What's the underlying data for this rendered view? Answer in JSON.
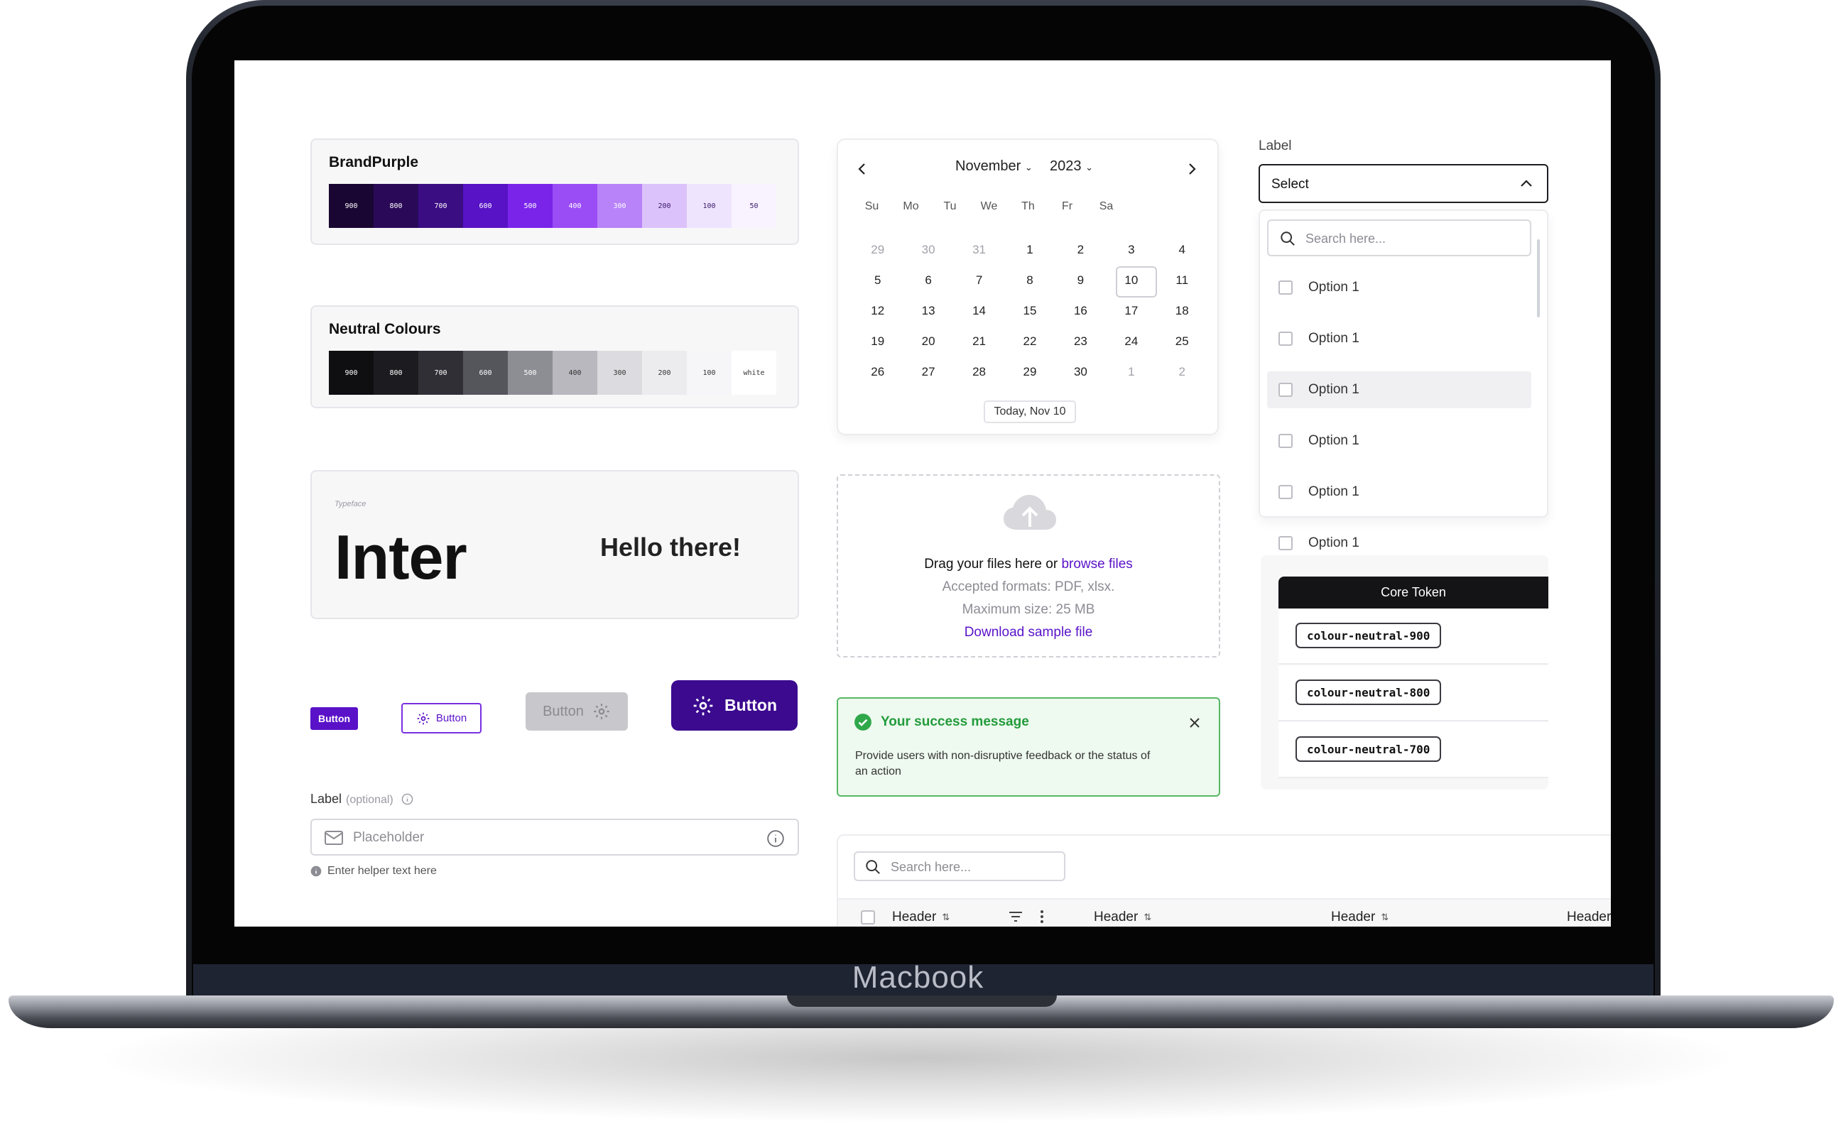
{
  "device": {
    "brand": "Macbook"
  },
  "palettes": [
    {
      "title": "BrandPurple",
      "swatches": [
        {
          "label": "900",
          "color": "#1a0633",
          "text": "#ffffff"
        },
        {
          "label": "800",
          "color": "#2a0a58",
          "text": "#ffffff"
        },
        {
          "label": "700",
          "color": "#3b0d82",
          "text": "#ffffff"
        },
        {
          "label": "600",
          "color": "#5713c5",
          "text": "#ffffff"
        },
        {
          "label": "500",
          "color": "#7a24ea",
          "text": "#ffffff"
        },
        {
          "label": "400",
          "color": "#9a4cf5",
          "text": "#ffffff"
        },
        {
          "label": "300",
          "color": "#b882f8",
          "text": "#ffffff"
        },
        {
          "label": "200",
          "color": "#dcc2fb",
          "text": "#3a1a6a"
        },
        {
          "label": "100",
          "color": "#efe4fd",
          "text": "#3a1a6a"
        },
        {
          "label": "50",
          "color": "#f8f3ff",
          "text": "#3a1a6a"
        }
      ]
    },
    {
      "title": "Neutral Colours",
      "swatches": [
        {
          "label": "900",
          "color": "#0f0f12",
          "text": "#ffffff"
        },
        {
          "label": "800",
          "color": "#1c1c20",
          "text": "#ffffff"
        },
        {
          "label": "700",
          "color": "#2f2f35",
          "text": "#ffffff"
        },
        {
          "label": "600",
          "color": "#55555c",
          "text": "#ffffff"
        },
        {
          "label": "500",
          "color": "#8d8d94",
          "text": "#ffffff"
        },
        {
          "label": "400",
          "color": "#b8b8be",
          "text": "#333333"
        },
        {
          "label": "300",
          "color": "#dcdce0",
          "text": "#333333"
        },
        {
          "label": "200",
          "color": "#ececef",
          "text": "#333333"
        },
        {
          "label": "100",
          "color": "#f6f6f8",
          "text": "#333333"
        },
        {
          "label": "white",
          "color": "#ffffff",
          "text": "#333333"
        }
      ]
    }
  ],
  "typeface": {
    "label": "Typeface",
    "name": "Inter",
    "sample": "Hello there!"
  },
  "buttons": {
    "small": "Button",
    "outline": "Button",
    "disabled": "Button",
    "large": "Button"
  },
  "text_field": {
    "label": "Label",
    "optional": "(optional)",
    "placeholder": "Placeholder",
    "helper": "Enter helper text here"
  },
  "calendar": {
    "month": "November",
    "year": "2023",
    "weekdays": [
      "Su",
      "Mo",
      "Tu",
      "We",
      "Th",
      "Fr",
      "Sa"
    ],
    "weeks": [
      [
        "29",
        "30",
        "31",
        "1",
        "2",
        "3",
        "4"
      ],
      [
        "5",
        "6",
        "7",
        "8",
        "9",
        "10",
        "11"
      ],
      [
        "12",
        "13",
        "14",
        "15",
        "16",
        "17",
        "18"
      ],
      [
        "19",
        "20",
        "21",
        "22",
        "23",
        "24",
        "25"
      ],
      [
        "26",
        "27",
        "28",
        "29",
        "30",
        "1",
        "2"
      ]
    ],
    "today_button": "Today, Nov 10"
  },
  "upload": {
    "prompt": "Drag your files here or",
    "link": "browse files",
    "formats": "Accepted formats: PDF, xlsx.",
    "max_size": "Maximum size: 25 MB",
    "download": "Download sample file"
  },
  "alert": {
    "title": "Your success message",
    "body": "Provide users with non-disruptive feedback or the status of an action"
  },
  "dropdown": {
    "label": "Label",
    "value": "Select",
    "search_placeholder": "Search here...",
    "options": [
      "Option 1",
      "Option 1",
      "Option 1",
      "Option 1",
      "Option 1",
      "Option 1"
    ],
    "highlighted_index": 2
  },
  "tokens": {
    "header": "Core Token",
    "items": [
      "colour-neutral-900",
      "colour-neutral-800",
      "colour-neutral-700"
    ]
  },
  "table": {
    "search_placeholder": "Search here...",
    "headers": [
      "Header",
      "Header",
      "Header",
      "Header"
    ]
  },
  "colors": {
    "brand": "#5a12c8",
    "brand_dark": "#3b0a8f",
    "success": "#239b3c"
  }
}
